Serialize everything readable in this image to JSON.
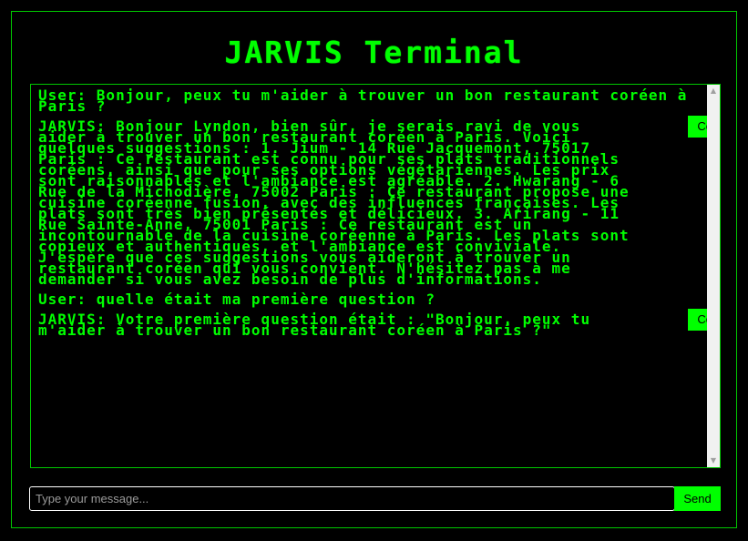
{
  "app": {
    "title": "JARVIS Terminal"
  },
  "messages": [
    {
      "role": "user",
      "text": "User: Bonjour, peux tu m'aider à trouver un bon restaurant coréen à Paris ?"
    },
    {
      "role": "bot",
      "text": "JARVIS: Bonjour Lyndon, bien sûr, je serais ravi de vous aider à trouver un bon restaurant coréen à Paris. Voici quelques suggestions : 1. Jium - 14 Rue Jacquemont, 75017 Paris : Ce restaurant est connu pour ses plats traditionnels coréens, ainsi que pour ses options végétariennes. Les prix sont raisonnables et l'ambiance est agréable. 2. Hwarang - 6 Rue de la Michodière, 75002 Paris : Ce restaurant propose une cuisine coréenne fusion, avec des influences françaises. Les plats sont très bien présentés et délicieux. 3. Arirang - 11 Rue Sainte-Anne, 75001 Paris : Ce restaurant est un incontournable de la cuisine coréenne à Paris. Les plats sont copieux et authentiques, et l'ambiance est conviviale. J'espère que ces suggestions vous aideront à trouver un restaurant coréen qui vous convient. N'hésitez pas à me demander si vous avez besoin de plus d'informations.",
      "copy_label": "Copy"
    },
    {
      "role": "user",
      "text": "User: quelle était ma première question ?"
    },
    {
      "role": "bot",
      "text": "JARVIS: Votre première question était : \"Bonjour, peux tu m'aider à trouver un bon restaurant coréen à Paris ?\"",
      "copy_label": "Copy"
    }
  ],
  "input": {
    "placeholder": "Type your message..."
  },
  "send_label": "Send",
  "colors": {
    "accent": "#00ff00",
    "background": "#000000",
    "border": "#00c800"
  }
}
